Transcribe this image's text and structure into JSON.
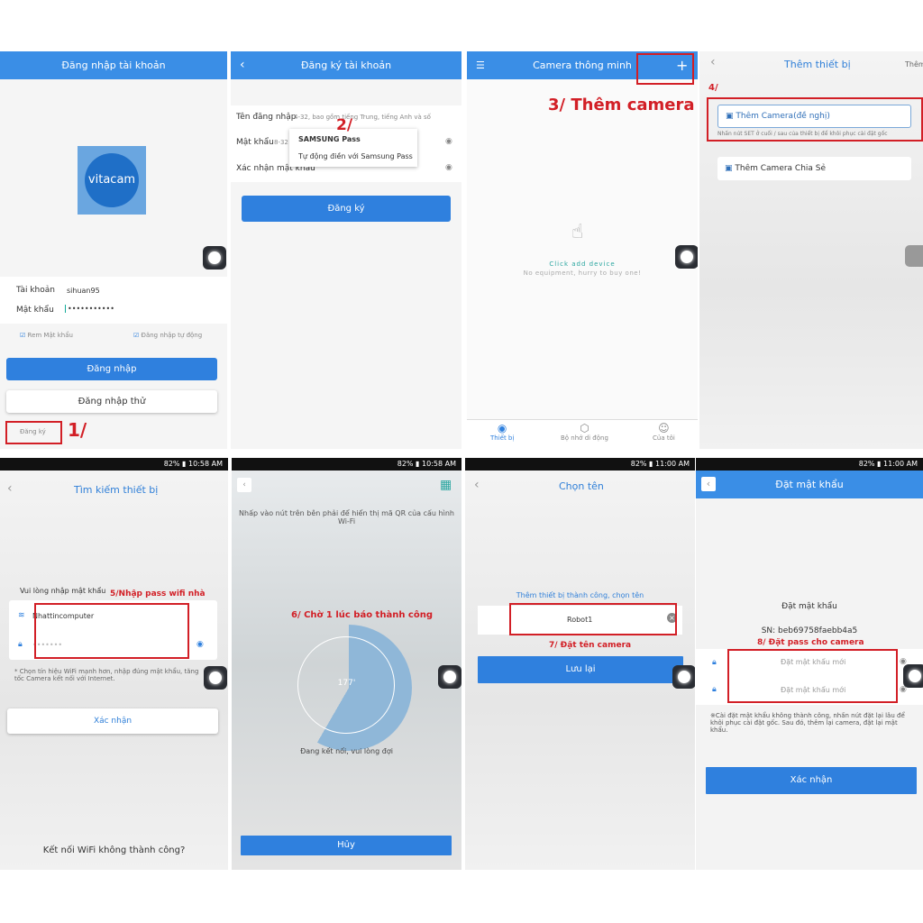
{
  "p1": {
    "title": "Đăng nhập tài khoản",
    "logo": "vitacam",
    "account_label": "Tài khoản",
    "account_value": "sihuan95",
    "password_label": "Mật khẩu",
    "password_value": "•••••••••••",
    "remember": "Rem Mật khẩu",
    "auto_login": "Đăng nhập tự động",
    "login": "Đăng nhập",
    "try_login": "Đăng nhập thử",
    "register": "Đăng ký",
    "step": "1/"
  },
  "p2": {
    "title": "Đăng ký tài khoản",
    "username_label": "Tên đăng nhập",
    "username_hint": "4-32, bao gồm tiếng Trung, tiếng Anh và số",
    "password_label": "Mật khẩu",
    "password_hint": "8-32",
    "confirm_label": "Xác nhận mật khẩu",
    "popup_brand": "SAMSUNG Pass",
    "popup_item": "Tự động điền với Samsung Pass",
    "register": "Đăng ký",
    "step": "2/"
  },
  "p3": {
    "title": "Camera thông minh",
    "step": "3/ Thêm camera",
    "click_add": "Click add device",
    "no_equipment": "No equipment, hurry to buy one!",
    "tabs": [
      "Thiết bị",
      "Bộ nhớ di động",
      "Của tôi"
    ]
  },
  "p4": {
    "title": "Thêm thiết bị",
    "right": "Thêm",
    "step": "4/",
    "add_camera": "Thêm Camera(đề nghị)",
    "hint": "Nhấn nút SET ở cuối / sau của thiết bị để khôi phục cài đặt gốc",
    "add_shared": "Thêm Camera Chia Sẻ"
  },
  "status": {
    "battery": "82%",
    "time_a": "10:58 AM",
    "time_b": "11:00 AM"
  },
  "p5": {
    "title": "Tìm kiếm thiết bị",
    "prompt": "Vui lòng nhập mật khẩu",
    "step": "5/Nhập pass wifi nhà",
    "ssid": "Nhattincomputer",
    "note": "* Chọn tín hiệu WiFi mạnh hơn, nhập đúng mật khẩu, tăng tốc Camera kết nối với Internet.",
    "confirm": "Xác nhận",
    "fail": "Kết nối WiFi không thành công?"
  },
  "p6": {
    "instruction": "Nhấp vào nút trên bên phải để hiển thị mã QR của cấu hình Wi-Fi",
    "step": "6/ Chờ 1 lúc báo thành công",
    "countdown": "177'",
    "connecting": "Đang kết nối, vui lòng đợi",
    "cancel": "Hủy"
  },
  "p7": {
    "title": "Chọn tên",
    "success": "Thêm thiết bị thành công, chọn tên",
    "name_value": "Robot1",
    "step": "7/ Đặt tên camera",
    "save": "Lưu lại"
  },
  "p8": {
    "title": "Đặt mật khẩu",
    "heading": "Đặt mật khẩu",
    "sn": "SN: beb69758faebb4a5",
    "step": "8/ Đặt pass cho camera",
    "new_pw": "Đặt mật khẩu mới",
    "new_pw2": "Đặt mật khẩu mới",
    "note": "※Cài đặt mật khẩu không thành công, nhấn nút đặt lại lâu để khôi phục cài đặt gốc. Sau đó, thêm lại camera, đặt lại mật khẩu.",
    "confirm": "Xác nhận"
  },
  "colors": {
    "primary": "#3a8ee6",
    "annotation": "#d21f26"
  }
}
